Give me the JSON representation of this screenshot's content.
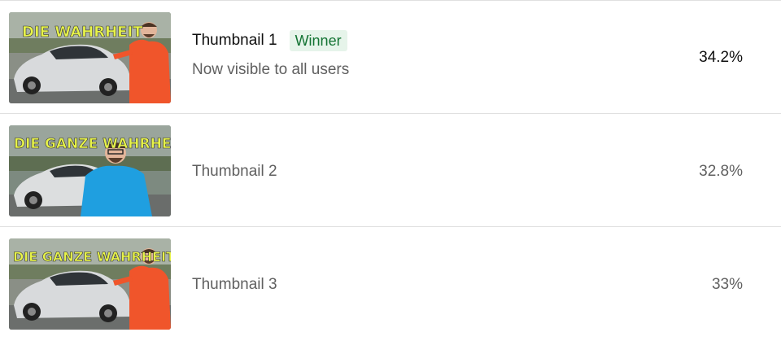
{
  "thumbnails": [
    {
      "title": "Thumbnail 1",
      "badge": "Winner",
      "subtitle": "Now visible to all users",
      "percentage": "34.2%",
      "image_text": "DIE WAHRHEIT",
      "jacket_color": "#f0552b"
    },
    {
      "title": "Thumbnail 2",
      "percentage": "32.8%",
      "image_text": "DIE GANZE WAHRHEIT",
      "jacket_color": "#1f9fe0"
    },
    {
      "title": "Thumbnail 3",
      "percentage": "33%",
      "image_text": "DIE GANZE WAHRHEIT",
      "jacket_color": "#f0552b"
    }
  ],
  "colors": {
    "winner_badge_bg": "#e6f4ea",
    "winner_badge_text": "#137333",
    "overlay_text": "#e8f44a"
  }
}
